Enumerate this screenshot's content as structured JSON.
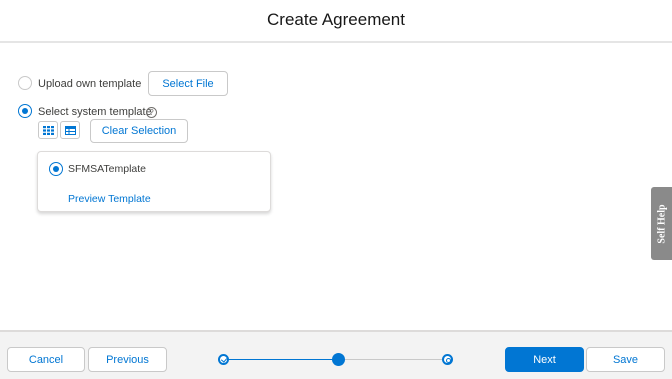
{
  "header": {
    "title": "Create Agreement"
  },
  "options": {
    "upload": {
      "label": "Upload own template",
      "button": "Select File",
      "selected": false
    },
    "system": {
      "label": "Select system template",
      "help": "?",
      "clear_button": "Clear Selection",
      "selected": true
    }
  },
  "view_toggle": [
    {
      "icon": "grid-view-icon"
    },
    {
      "icon": "table-view-icon"
    }
  ],
  "template_card": {
    "name": "SFMSATemplate",
    "preview_link": "Preview Template",
    "selected": true
  },
  "self_help": {
    "label": "Self Help"
  },
  "footer": {
    "cancel": "Cancel",
    "previous": "Previous",
    "next": "Next",
    "save": "Save",
    "progress": {
      "total_steps": 3,
      "current_step": 2
    }
  },
  "colors": {
    "brand": "#0176d3",
    "border": "#c9c9c9",
    "footer_bg": "#f3f3f3",
    "self_help_bg": "#8a8a8a"
  }
}
